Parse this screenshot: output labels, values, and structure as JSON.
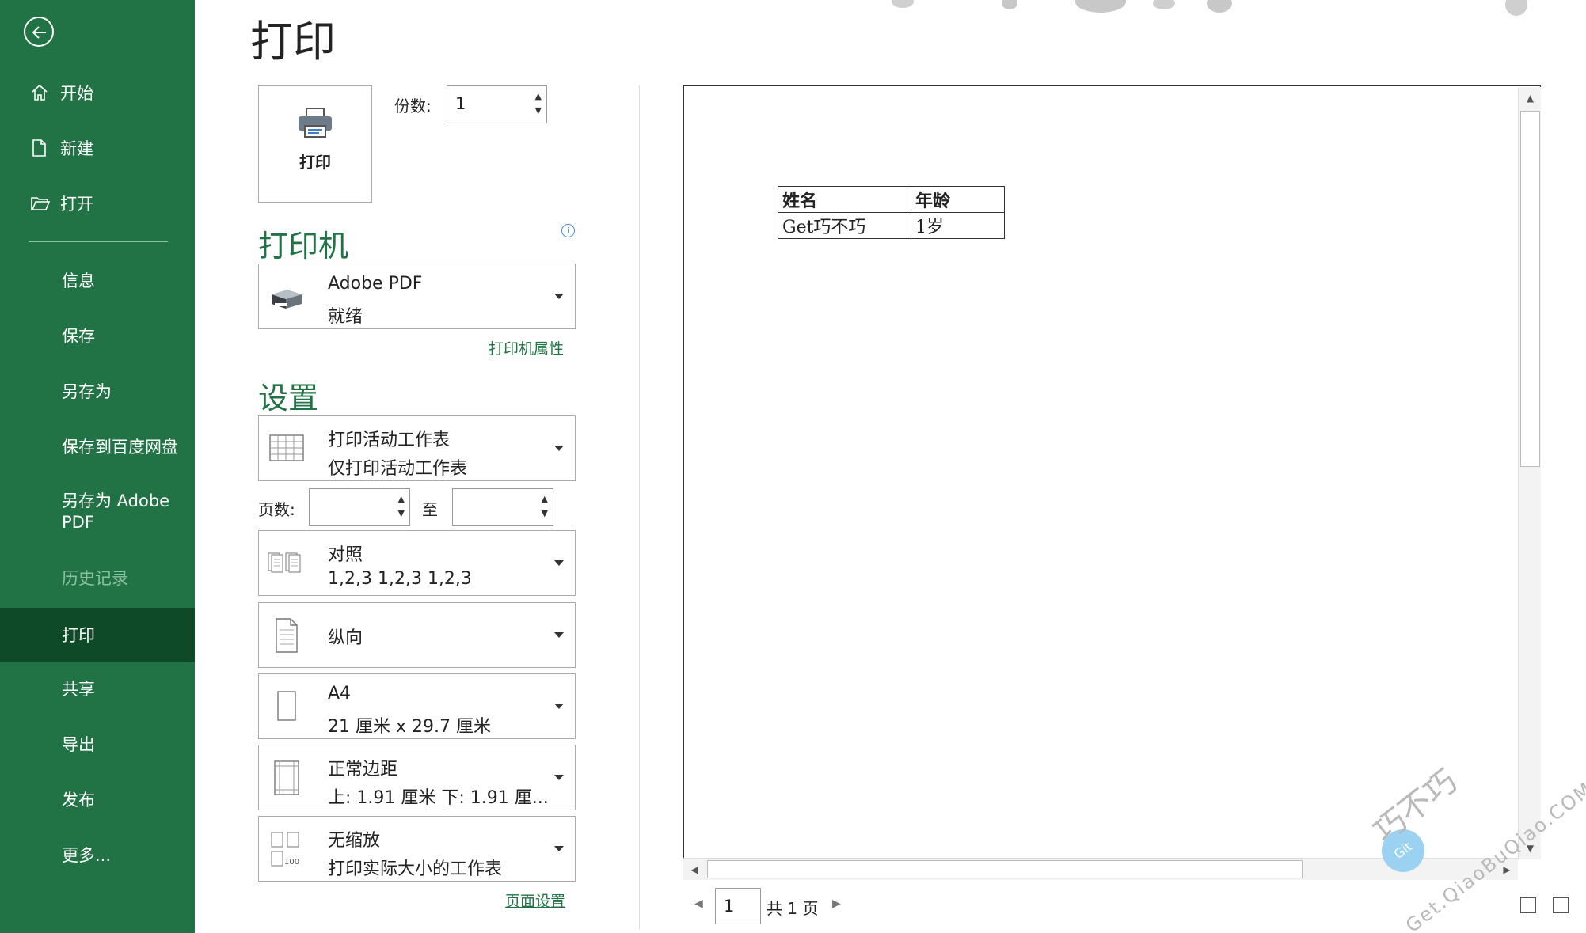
{
  "sidebar": {
    "items": [
      {
        "label": "开始",
        "icon": "home-icon"
      },
      {
        "label": "新建",
        "icon": "new-document-icon"
      },
      {
        "label": "打开",
        "icon": "open-folder-icon"
      },
      {
        "label": "信息"
      },
      {
        "label": "保存"
      },
      {
        "label": "另存为"
      },
      {
        "label": "保存到百度网盘"
      },
      {
        "label": "另存为 Adobe PDF"
      },
      {
        "label": "历史记录",
        "state": "disabled"
      },
      {
        "label": "打印",
        "state": "active"
      },
      {
        "label": "共享"
      },
      {
        "label": "导出"
      },
      {
        "label": "发布"
      },
      {
        "label": "更多..."
      }
    ]
  },
  "main": {
    "title": "打印",
    "print_button_label": "打印",
    "copies_label": "份数:",
    "copies_value": "1",
    "printer_section": "打印机",
    "printer": {
      "name": "Adobe PDF",
      "status": "就绪"
    },
    "printer_properties_link": "打印机属性",
    "settings_section": "设置",
    "settings": [
      {
        "line1": "打印活动工作表",
        "line2": "仅打印活动工作表",
        "icon": "sheet-grid-icon"
      },
      {
        "line1": "对照",
        "line2": "1,2,3    1,2,3    1,2,3",
        "icon": "collate-icon"
      },
      {
        "line1": "纵向",
        "line2": "",
        "icon": "portrait-page-icon"
      },
      {
        "line1": "A4",
        "line2": "21 厘米 x 29.7 厘米",
        "icon": "paper-size-icon"
      },
      {
        "line1": "正常边距",
        "line2": "上: 1.91 厘米 下: 1.91 厘...",
        "icon": "margins-icon"
      },
      {
        "line1": "无缩放",
        "line2": "打印实际大小的工作表",
        "icon": "scaling-icon"
      }
    ],
    "pages_label": "页数:",
    "to_label": "至",
    "page_setup_link": "页面设置"
  },
  "preview": {
    "table": {
      "headers": [
        "姓名",
        "年龄"
      ],
      "rows": [
        [
          "Get巧不巧",
          "1岁"
        ]
      ]
    },
    "current_page": "1",
    "total_pages_text": "共 1 页"
  },
  "watermark": {
    "brand": "巧不巧",
    "url": "Get.QiaoBuQiao.COM",
    "badge": "Git"
  },
  "colors": {
    "accent": "#217346",
    "active": "#0f4a28"
  }
}
